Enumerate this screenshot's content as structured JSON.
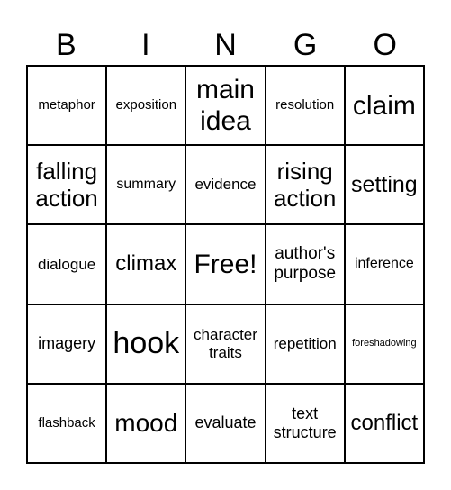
{
  "header": {
    "letters": [
      "B",
      "I",
      "N",
      "G",
      "O"
    ]
  },
  "board": {
    "rows": [
      [
        "metaphor",
        "exposition",
        "main\nidea",
        "resolution",
        "claim"
      ],
      [
        "falling\naction",
        "summary",
        "evidence",
        "rising\naction",
        "setting"
      ],
      [
        "dialogue",
        "climax",
        "Free!",
        "author's\npurpose",
        "inference"
      ],
      [
        "imagery",
        "hook",
        "character\ntraits",
        "repetition",
        "foreshadowing"
      ],
      [
        "flashback",
        "mood",
        "evaluate",
        "text\nstructure",
        "conflict"
      ]
    ],
    "free_space": "Free!"
  },
  "colors": {
    "background": "#ffffff",
    "text": "#000000",
    "grid_lines": "#000000"
  }
}
